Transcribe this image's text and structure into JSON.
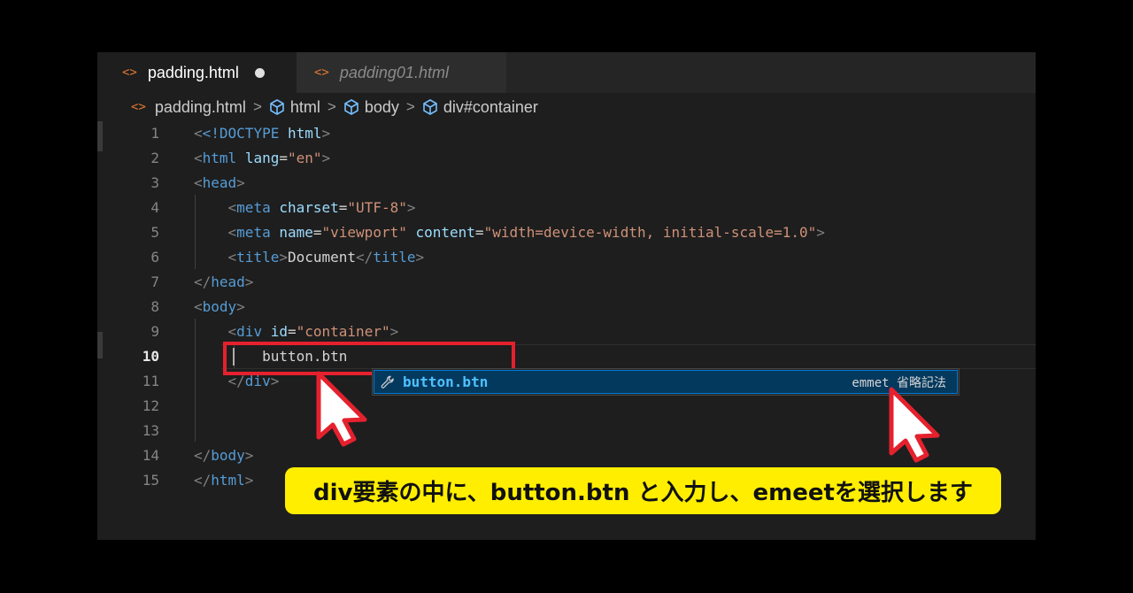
{
  "tabs": [
    {
      "label": "padding.html",
      "active": true,
      "modified": true,
      "icon": "code-brackets-icon"
    },
    {
      "label": "padding01.html",
      "active": false,
      "modified": false,
      "icon": "code-brackets-icon"
    }
  ],
  "breadcrumb": {
    "file": "padding.html",
    "items": [
      "html",
      "body",
      "div#container"
    ]
  },
  "code": {
    "current_line": 10,
    "lines": [
      {
        "n": "1"
      },
      {
        "n": "2"
      },
      {
        "n": "3"
      },
      {
        "n": "4"
      },
      {
        "n": "5"
      },
      {
        "n": "6"
      },
      {
        "n": "7"
      },
      {
        "n": "8"
      },
      {
        "n": "9"
      },
      {
        "n": "10"
      },
      {
        "n": "11"
      },
      {
        "n": "12"
      },
      {
        "n": "13"
      },
      {
        "n": "14"
      },
      {
        "n": "15"
      }
    ],
    "tokens": {
      "doctype": "<!DOCTYPE",
      "html_kw": "html",
      "gt": ">",
      "lt": "<",
      "lt_slash": "</",
      "html": "html",
      "lang_attr": "lang",
      "eq": "=",
      "lang_val": "\"en\"",
      "head": "head",
      "meta": "meta",
      "charset_attr": "charset",
      "charset_val": "\"UTF-8\"",
      "name_attr": "name",
      "name_val": "\"viewport\"",
      "content_attr": "content",
      "content_val": "\"width=device-width, initial-scale=1.0\"",
      "title": "title",
      "title_text": "Document",
      "body": "body",
      "div": "div",
      "id_attr": "id",
      "id_val": "\"container\"",
      "typed_text": "button.btn"
    }
  },
  "suggestion": {
    "label": "button.btn",
    "detail": "emmet 省略記法",
    "icon": "wrench-icon"
  },
  "caption": "div要素の中に、button.btn と入力し、emeetを選択します",
  "colors": {
    "highlight_box": "#e5212e",
    "caption_bg": "#ffee00",
    "tag": "#569cd6",
    "attribute": "#9cdcfe",
    "string": "#ce9178",
    "suggestion_bg": "#04395e"
  }
}
